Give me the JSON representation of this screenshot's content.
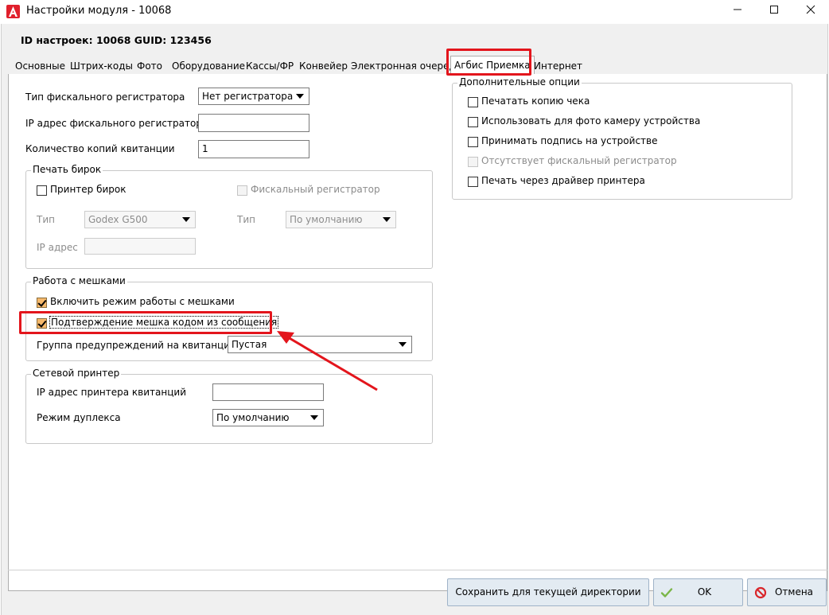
{
  "window": {
    "title": "Настройки модуля  - 10068",
    "minimize": "—",
    "maximize": "☐",
    "close": "✕"
  },
  "header": {
    "id_line": "ID настроек: 10068   GUID: 123456"
  },
  "tabs": [
    {
      "label": "Основные"
    },
    {
      "label": "Штрих-коды"
    },
    {
      "label": "Фото"
    },
    {
      "label": "Оборудование"
    },
    {
      "label": "Кассы/ФР"
    },
    {
      "label": "Конвейер"
    },
    {
      "label": "Электронная очередь"
    },
    {
      "label": "Агбис Приемка",
      "active": true
    },
    {
      "label": "Интернет"
    }
  ],
  "left": {
    "fiscal_type_label": "Тип фискального регистратора",
    "fiscal_type_value": "Нет регистратора",
    "fiscal_ip_label": "IP адрес фискального регистратора",
    "fiscal_ip_value": "",
    "copies_label": "Количество копий квитанции",
    "copies_value": "1"
  },
  "tags_group": {
    "title": "Печать бирок",
    "tag_printer_label": "Принтер бирок",
    "fiscal_registrar_label": "Фискальный регистратор",
    "type_label_1": "Тип",
    "type_value_1": "Godex G500",
    "type_label_2": "Тип",
    "type_value_2": "По умолчанию",
    "ip_label": "IP адрес",
    "ip_value": ""
  },
  "bags_group": {
    "title": "Работа с мешками",
    "enable_label": "Включить режим работы с мешками",
    "enable_checked": true,
    "confirm_label": "Подтверждение мешка кодом из сообщения",
    "confirm_checked": true,
    "warning_group_label": "Группа предупреждений на квитанции",
    "warning_group_value": "Пустая"
  },
  "network_group": {
    "title": "Сетевой принтер",
    "ip_label": "IP адрес принтера квитанций",
    "ip_value": "",
    "duplex_label": "Режим дуплекса",
    "duplex_value": "По умолчанию"
  },
  "extra_group": {
    "title": "Дополнительные опции",
    "options": [
      {
        "label": "Печатать копию чека",
        "checked": false,
        "disabled": false
      },
      {
        "label": "Использовать для фото камеру устройства",
        "checked": false,
        "disabled": false
      },
      {
        "label": "Принимать подпись на устройстве",
        "checked": false,
        "disabled": false
      },
      {
        "label": "Отсутствует фискальный регистратор",
        "checked": false,
        "disabled": true
      },
      {
        "label": "Печать через драйвер принтера",
        "checked": false,
        "disabled": false
      }
    ]
  },
  "buttons": {
    "save_dir": "Сохранить для текущей директории",
    "ok": "OK",
    "cancel": "Отмена"
  },
  "colors": {
    "annotation": "#e3151c",
    "checkbox_on": "#f5b86b",
    "ok_icon": "#7ab648",
    "cancel_icon": "#d9262b"
  }
}
